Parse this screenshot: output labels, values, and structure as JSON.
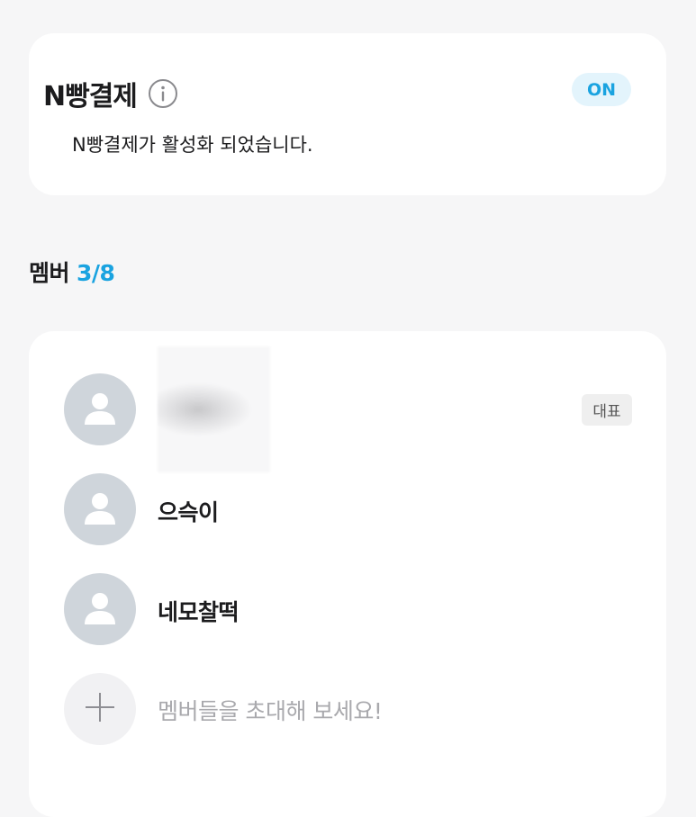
{
  "npay": {
    "title": "N빵결제",
    "info_icon": "info-icon",
    "toggle_label": "ON",
    "description": "N빵결제가 활성화 되었습니다.",
    "accent_color": "#1aa3e0"
  },
  "members": {
    "heading": "멤버",
    "count": "3/8",
    "list": [
      {
        "name": "",
        "badge": "대표",
        "avatar_icon": "user-avatar-icon"
      },
      {
        "name": "으슥이",
        "avatar_icon": "user-avatar-icon"
      },
      {
        "name": "네모찰떡",
        "avatar_icon": "user-avatar-icon"
      }
    ],
    "invite_icon": "plus-icon",
    "invite_text": "멤버들을 초대해 보세요!"
  }
}
